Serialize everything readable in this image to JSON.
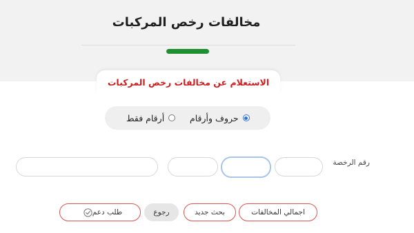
{
  "header": {
    "title": "مخالفات رخص المركبات"
  },
  "section": {
    "title": "الاستعلام عن مخالفات رخص المركبات"
  },
  "search_mode": {
    "options": [
      {
        "label": "حروف وأرقام",
        "selected": true
      },
      {
        "label": "أرقام فقط",
        "selected": false
      }
    ]
  },
  "plate_form": {
    "label": "رقم الرخصة",
    "fields": [
      "",
      "",
      "",
      ""
    ]
  },
  "actions": {
    "total_label": "اجمالي المخالفات",
    "new_search_label": "بحث جديد",
    "back_label": "رجوع",
    "support_label": "طلب دعم"
  },
  "colors": {
    "accent_green": "#1e8f2e",
    "title_red": "#cc1f1f",
    "button_border_red": "#d9534f",
    "radio_blue": "#2f6fe0"
  },
  "icons": {
    "support": "check-circle-icon"
  }
}
